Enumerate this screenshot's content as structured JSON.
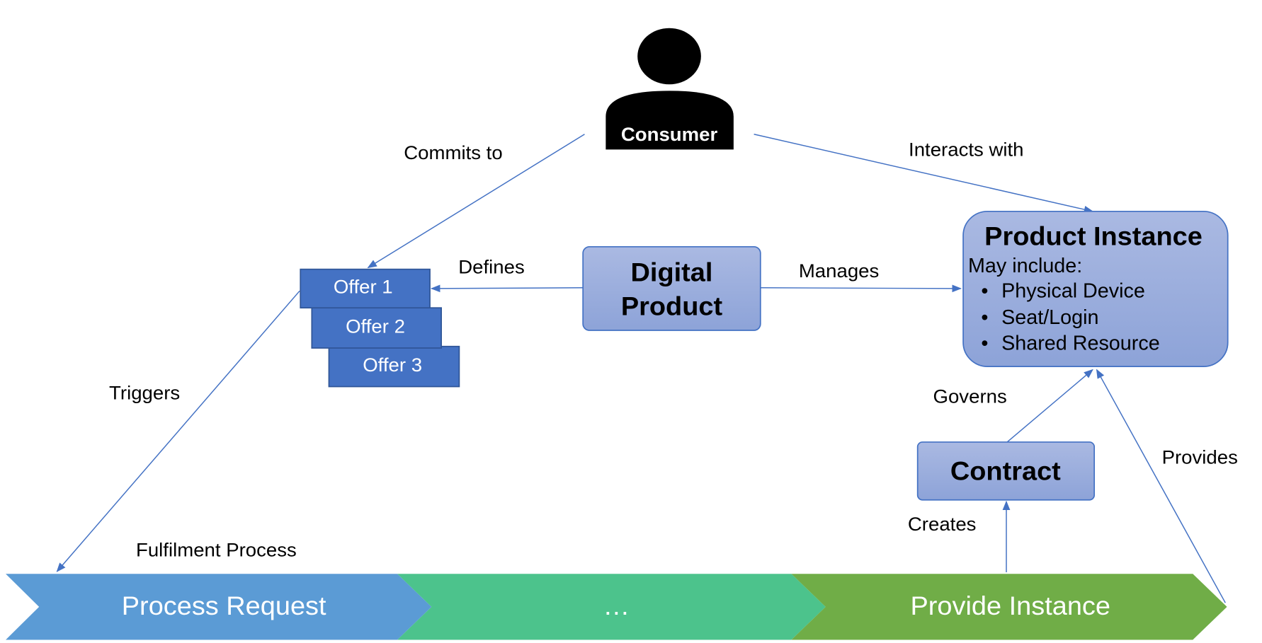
{
  "consumer": {
    "label": "Consumer",
    "icon": "person-icon"
  },
  "relations": {
    "commits_to": "Commits to",
    "interacts_with": "Interacts with",
    "defines": "Defines",
    "manages": "Manages",
    "triggers": "Triggers",
    "governs": "Governs",
    "creates": "Creates",
    "provides": "Provides"
  },
  "offers": [
    "Offer 1",
    "Offer 2",
    "Offer 3"
  ],
  "digital_product": {
    "line1": "Digital",
    "line2": "Product"
  },
  "product_instance": {
    "title": "Product Instance",
    "subtitle": "May include:",
    "items": [
      "Physical Device",
      "Seat/Login",
      "Shared Resource"
    ]
  },
  "contract": "Contract",
  "fulfilment": {
    "title": "Fulfilment Process",
    "steps": [
      "Process Request",
      "…",
      "Provide Instance"
    ]
  },
  "colors": {
    "connector": "#4472C4",
    "offer": "#4472C4",
    "box_fill_top": "#A9B9E2",
    "box_fill_bottom": "#8EA4D8",
    "step_1": "#5B9BD5",
    "step_2": "#4CC38C",
    "step_3": "#70AD47"
  }
}
